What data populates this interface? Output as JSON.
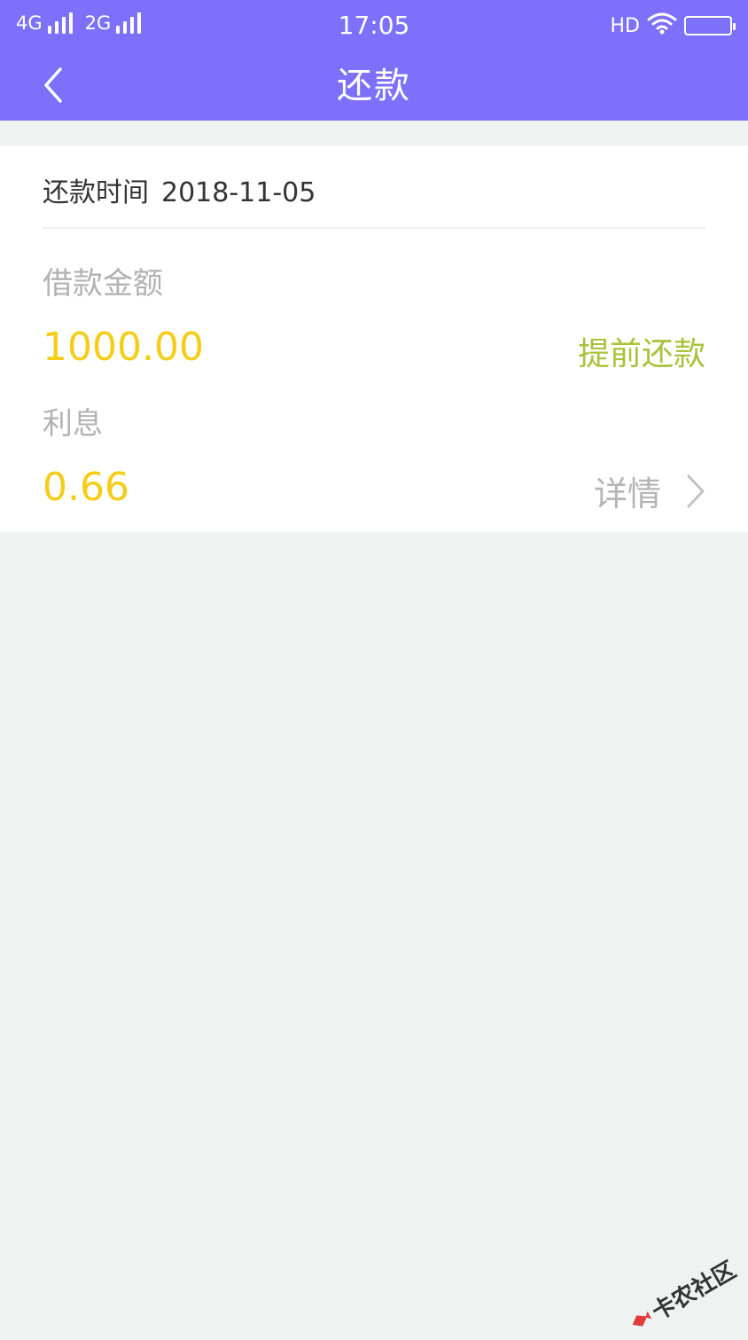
{
  "status_bar": {
    "network1": "4G",
    "network2": "2G",
    "time": "17:05",
    "hd": "HD"
  },
  "header": {
    "title": "还款"
  },
  "repayment": {
    "date_label": "还款时间",
    "date_value": "2018-11-05",
    "principal_label": "借款金额",
    "principal_value": "1000.00",
    "prepay_label": "提前还款",
    "interest_label": "利息",
    "interest_value": "0.66",
    "details_label": "详情"
  },
  "watermark": {
    "text": "卡农社区"
  },
  "colors": {
    "header_bg": "#7e70fa",
    "amount": "#f7cc16",
    "prepay": "#a7c33a",
    "page_bg": "#eef2f1"
  }
}
